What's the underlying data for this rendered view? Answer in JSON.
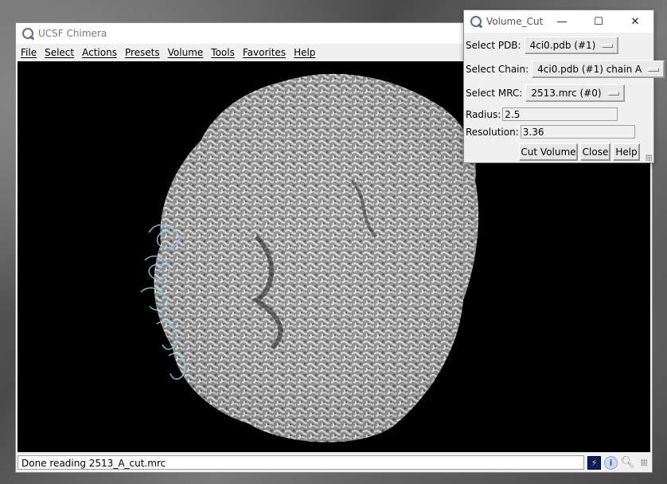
{
  "main_window": {
    "title": "UCSF Chimera",
    "menu": [
      "File",
      "Select",
      "Actions",
      "Presets",
      "Volume",
      "Tools",
      "Favorites",
      "Help"
    ],
    "status_text": "Done reading 2513_A_cut.mrc",
    "status_icons": [
      "lightning-bolt-icon",
      "info-icon",
      "magnifier-icon"
    ]
  },
  "dialog": {
    "title": "Volume_Cut",
    "controls": {
      "minimize": "—",
      "maximize": "☐",
      "close": "✕"
    },
    "select_pdb_label": "Select PDB:",
    "select_pdb_value": "4ci0.pdb (#1)",
    "select_chain_label": "Select Chain:",
    "select_chain_value": "4ci0.pdb (#1) chain A",
    "select_mrc_label": "Select MRC:",
    "select_mrc_value": "2513.mrc (#0)",
    "radius_label": "Radius:",
    "radius_value": "2.5",
    "resolution_label": "Resolution:",
    "resolution_value": "3.36",
    "buttons": {
      "cut": "Cut Volume",
      "close": "Close",
      "help": "Help"
    }
  },
  "colors": {
    "viewport_bg": "#000000",
    "density_surface": "#bdbdbd",
    "chain_ribbon": "#8ecae6"
  }
}
